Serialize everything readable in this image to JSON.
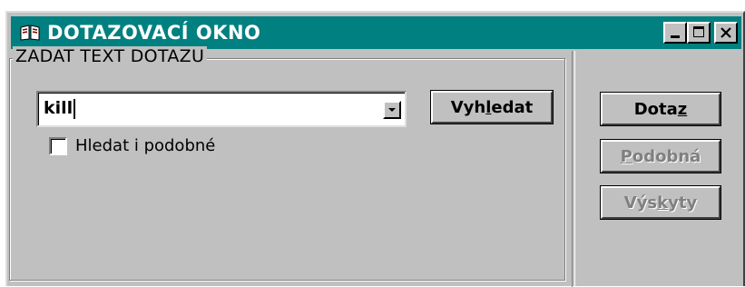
{
  "window": {
    "title": "DOTAZOVACÍ OKNO",
    "title_bar_color": "#008080",
    "icon": "book-icon"
  },
  "group": {
    "label": "ZADAT TEXT DOTAZU"
  },
  "query": {
    "value": "kill"
  },
  "search_button": {
    "pre": "Vyh",
    "mnemonic": "l",
    "post": "edat"
  },
  "similar_checkbox": {
    "label": "Hledat i podobné",
    "checked": false
  },
  "side_buttons": {
    "query": {
      "pre": "Dota",
      "mnemonic": "z",
      "post": "",
      "enabled": true
    },
    "similar": {
      "pre": "",
      "mnemonic": "P",
      "post": "odobná",
      "enabled": false
    },
    "occurrences": {
      "pre": "Výs",
      "mnemonic": "k",
      "post": "yty",
      "enabled": false
    }
  }
}
